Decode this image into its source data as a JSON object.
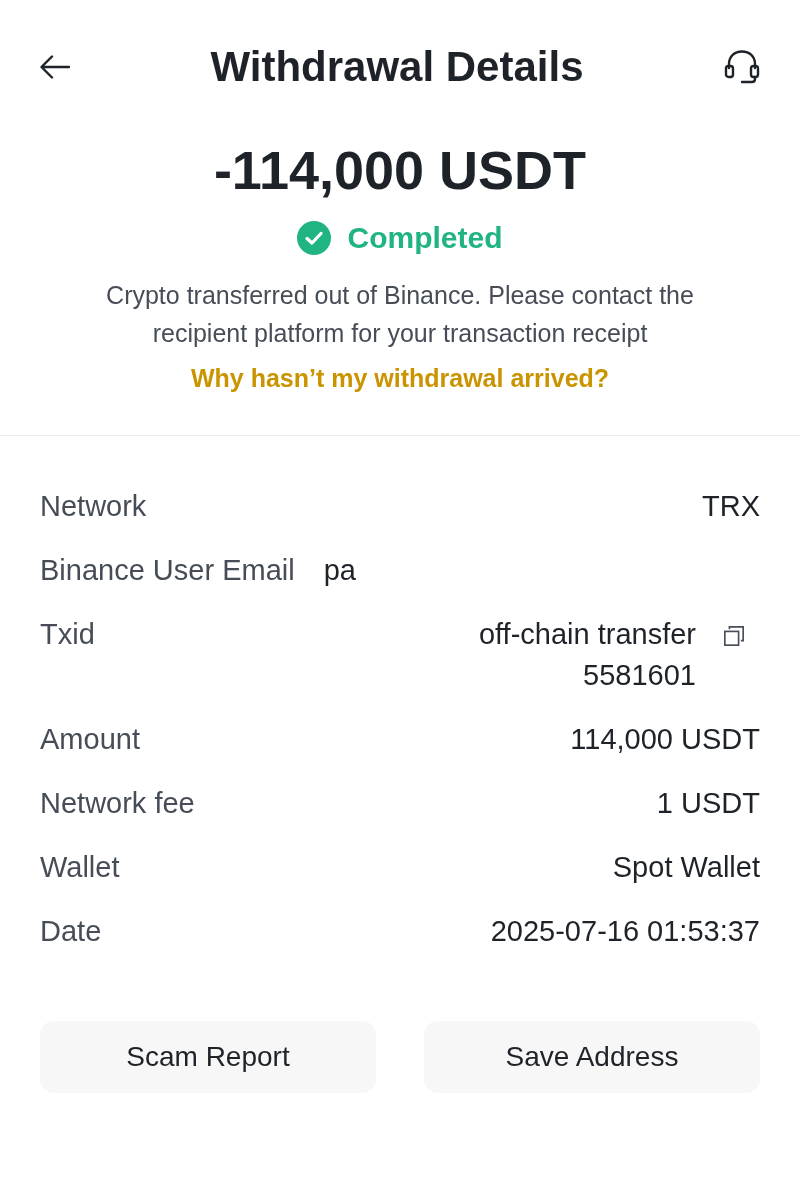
{
  "header": {
    "title": "Withdrawal Details"
  },
  "summary": {
    "amount": "-114,000 USDT",
    "status": {
      "label": "Completed",
      "kind": "success"
    },
    "message": "Crypto transferred out of Binance. Please contact the recipient platform for your transaction receipt",
    "help_link": "Why hasn’t my withdrawal arrived?"
  },
  "details": [
    {
      "label": "Network",
      "value": "TRX",
      "kind": "text"
    },
    {
      "label": "Binance User Email",
      "value": "pa",
      "kind": "masked"
    },
    {
      "label": "Txid",
      "value": "off-chain transfer 5581601",
      "kind": "copyable"
    },
    {
      "label": "Amount",
      "value": "114,000 USDT",
      "kind": "text"
    },
    {
      "label": "Network fee",
      "value": "1 USDT",
      "kind": "text"
    },
    {
      "label": "Wallet",
      "value": "Spot Wallet",
      "kind": "text"
    },
    {
      "label": "Date",
      "value": "2025-07-16 01:53:37",
      "kind": "text"
    }
  ],
  "buttons": [
    "Scam Report",
    "Save Address"
  ]
}
